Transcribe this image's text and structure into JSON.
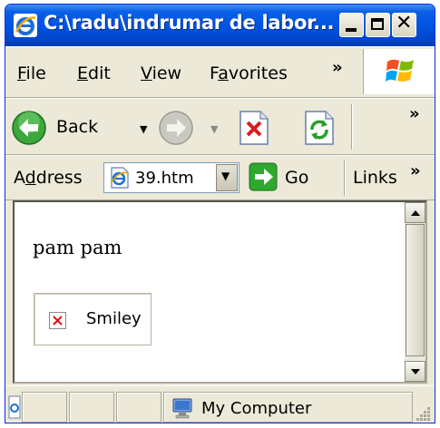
{
  "window": {
    "title": "C:\\radu\\indrumar de labor..."
  },
  "menu": {
    "items": [
      {
        "pre": "",
        "ul": "F",
        "post": "ile"
      },
      {
        "pre": "",
        "ul": "E",
        "post": "dit"
      },
      {
        "pre": "",
        "ul": "V",
        "post": "iew"
      },
      {
        "pre": "F",
        "ul": "a",
        "post": "vorites"
      }
    ],
    "overflow": "»"
  },
  "toolbar": {
    "back_label": "Back",
    "overflow": "»",
    "icons": [
      "back-arrow-icon",
      "forward-arrow-icon",
      "stop-icon",
      "refresh-icon"
    ]
  },
  "address": {
    "label_pre": "A",
    "label_ul": "d",
    "label_post": "dress",
    "value": "39.htm",
    "go_label": "Go",
    "links_label": "Links",
    "overflow": "»"
  },
  "page": {
    "text": "pam pam",
    "image_alt": "Smiley"
  },
  "status": {
    "zone": "My Computer"
  },
  "colors": {
    "titlebar": "#0054e3",
    "chrome": "#ece9d8",
    "go_green": "#2fa82f"
  }
}
